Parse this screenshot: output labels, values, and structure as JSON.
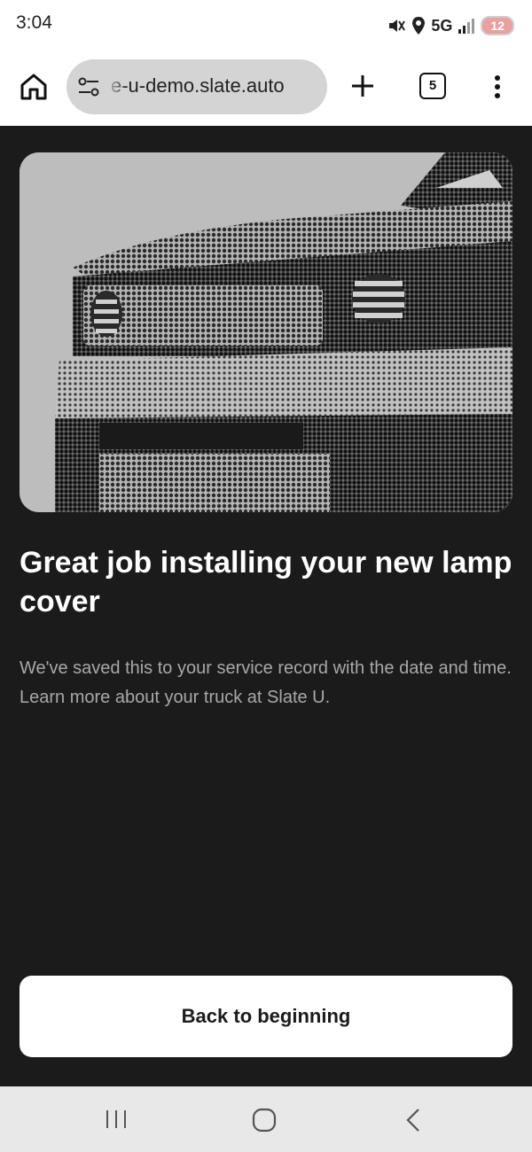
{
  "status_bar": {
    "time": "3:04",
    "network": "5G",
    "battery": "12",
    "icons": [
      "mute-icon",
      "location-icon",
      "signal-icon",
      "battery-icon"
    ]
  },
  "browser": {
    "url": "e-u-demo.slate.auto",
    "tab_count": "5",
    "icons": [
      "home-icon",
      "site-settings-icon",
      "plus-icon",
      "tabs-icon",
      "more-vert-icon"
    ]
  },
  "content": {
    "headline": "Great job installing your new lamp cover",
    "body": "We've saved this to your service record with the date and time. Learn more about your truck at Slate U.",
    "button_label": "Back to beginning"
  },
  "nav_bar": {
    "icons": [
      "recents-icon",
      "home-circle-icon",
      "back-icon"
    ]
  },
  "colors": {
    "background": "#1b1b1b",
    "headline": "#ffffff",
    "body_text": "#a8a8a8",
    "button_bg": "#ffffff",
    "button_text": "#1b1b1b",
    "url_box": "#d4d4d4"
  }
}
